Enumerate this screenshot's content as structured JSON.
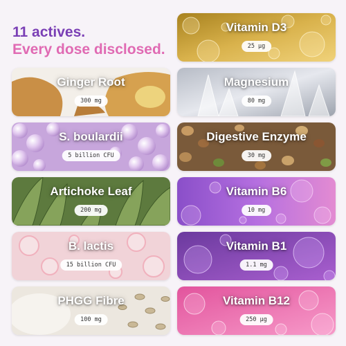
{
  "headline": {
    "line1": "11 actives.",
    "line2": "Every dose disclosed."
  },
  "colors": {
    "headline_purple": "#7a3fb5",
    "headline_pink": "#e06ab3"
  },
  "actives": [
    {
      "name": "Vitamin D3",
      "dose": "25 µg",
      "texture": "golden-oil-bubbles"
    },
    {
      "name": "Ginger Root",
      "dose": "300 mg",
      "texture": "ginger-root"
    },
    {
      "name": "Magnesium",
      "dose": "80 mg",
      "texture": "white-crystals"
    },
    {
      "name": "S. boulardii",
      "dose": "5 billion CFU",
      "texture": "lilac-pearls"
    },
    {
      "name": "Digestive Enzyme",
      "dose": "30 mg",
      "texture": "legumes-seeds"
    },
    {
      "name": "Artichoke Leaf",
      "dose": "200 mg",
      "texture": "artichoke-leaves"
    },
    {
      "name": "Vitamin B6",
      "dose": "10 mg",
      "texture": "violet-oil-bubbles"
    },
    {
      "name": "B. lactis",
      "dose": "15 billion CFU",
      "texture": "pink-microbes"
    },
    {
      "name": "Vitamin B1",
      "dose": "1.1 mg",
      "texture": "purple-bubbles"
    },
    {
      "name": "PHGG Fibre",
      "dose": "100 mg",
      "texture": "powder-and-seeds"
    },
    {
      "name": "Vitamin B12",
      "dose": "250 µg",
      "texture": "magenta-bubbles"
    }
  ]
}
